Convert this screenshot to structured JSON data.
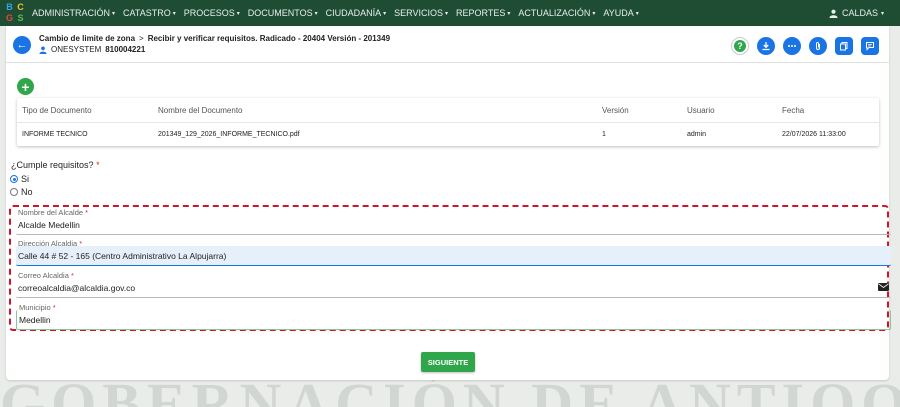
{
  "brand": {
    "logo_letters": [
      "B",
      "C",
      "G",
      "S"
    ],
    "logo_colors": [
      "#3aa0e6",
      "#f2c230",
      "#e2473b",
      "#5bbf4f"
    ]
  },
  "navbar": {
    "items": [
      {
        "label": "ADMINISTRACIÓN"
      },
      {
        "label": "CATASTRO"
      },
      {
        "label": "PROCESOS"
      },
      {
        "label": "DOCUMENTOS"
      },
      {
        "label": "CIUDADANÍA"
      },
      {
        "label": "SERVICIOS"
      },
      {
        "label": "REPORTES"
      },
      {
        "label": "ACTUALIZACIÓN"
      },
      {
        "label": "AYUDA"
      }
    ],
    "user_label": "CALDAS",
    "caret": "▾"
  },
  "header": {
    "breadcrumb_1": "Cambio de limite de zona",
    "breadcrumb_sep": ">",
    "breadcrumb_2": "Recibir y verificar requisitos. Radicado - 20404 Versión - 201349",
    "org_name": "ONESYSTEM",
    "org_nit": "810004221",
    "back_arrow": "←",
    "help_glyph": "?"
  },
  "documents": {
    "add_glyph": "+",
    "columns": [
      "Tipo de Documento",
      "Nombre del Documento",
      "Versión",
      "Usuario",
      "Fecha"
    ],
    "rows": [
      {
        "tipo": "INFORME TECNICO",
        "nombre": "201349_129_2026_INFORME_TECNICO.pdf",
        "version": "1",
        "usuario": "admin",
        "fecha": "22/07/2026 11:33:00"
      }
    ]
  },
  "requisitos": {
    "question": "¿Cumple requisitos?",
    "required_mark": "*",
    "options": [
      {
        "label": "Si",
        "selected": true
      },
      {
        "label": "No",
        "selected": false
      }
    ]
  },
  "form": {
    "nombre_alcalde": {
      "label": "Nombre del Alcalde",
      "value": "Alcalde Medellin"
    },
    "direccion": {
      "label": "Dirección Alcaldia",
      "value": "Calle 44 # 52 - 165 (Centro Administrativo La Alpujarra)"
    },
    "correo": {
      "label": "Correo Alcaldia",
      "value": "correoalcaldia@alcaldia.gov.co"
    },
    "municipio": {
      "label": "Municipio",
      "value": "Medellin"
    }
  },
  "footer": {
    "next_label": "SIGUIENTE",
    "watermark": "GOBERNACIÓN DE ANTIOQUIA"
  },
  "colors": {
    "nav_bg": "#1f4d34",
    "primary": "#1b74e4",
    "success": "#2fa64a",
    "highlight_border": "#d0142c"
  }
}
